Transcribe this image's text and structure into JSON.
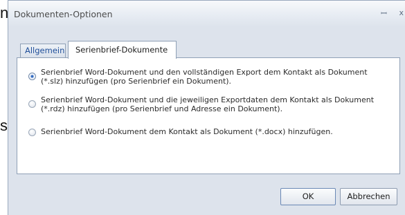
{
  "background_fragments": {
    "top_char": "n",
    "mid_char": "s"
  },
  "window": {
    "title": "Dokumenten-Optionen",
    "pin_glyph": "ꟷ",
    "close_glyph": "x"
  },
  "tabs": [
    {
      "label": "Allgemein",
      "selected": false
    },
    {
      "label": "Serienbrief-Dokumente",
      "selected": true
    }
  ],
  "options": [
    {
      "line1": "Serienbrief Word-Dokument und den vollständigen Export dem Kontakt als Dokument",
      "line2": "(*.slz) hinzufügen (pro Serienbrief ein Dokument).",
      "checked": true
    },
    {
      "line1": "Serienbrief Word-Dokument und die jeweiligen Exportdaten dem Kontakt als Dokument",
      "line2": "(*.rdz) hinzufügen (pro Serienbrief und Adresse ein Dokument).",
      "checked": false
    },
    {
      "line1": "Serienbrief Word-Dokument dem Kontakt als Dokument (*.docx) hinzufügen.",
      "checked": false
    }
  ],
  "buttons": {
    "ok_label": "OK",
    "cancel_label": "Abbrechen"
  },
  "colors": {
    "title_bar": "#dde3ec",
    "accent_radio": "#2e64b8",
    "tab_text_inactive": "#1f4f9a"
  }
}
